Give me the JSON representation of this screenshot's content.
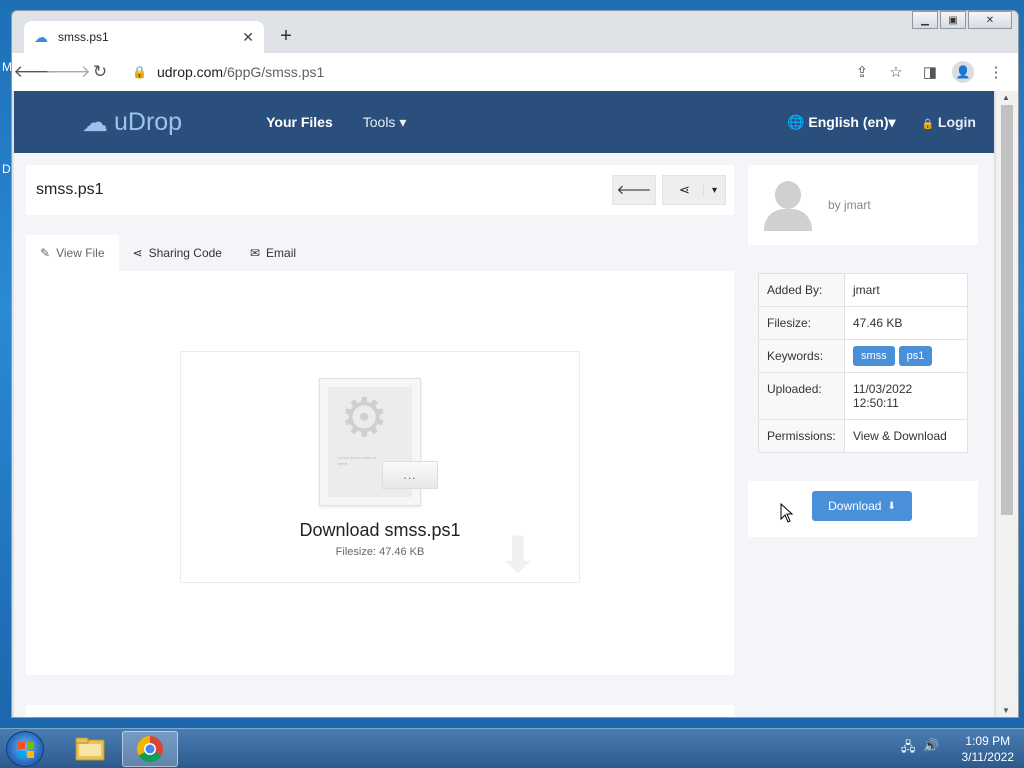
{
  "desktop": {
    "icon_text_1": "M",
    "icon_text_2": "D"
  },
  "browser": {
    "tab_title": "smss.ps1",
    "new_tab": "+",
    "url_host": "udrop.com",
    "url_path": "/6ppG/smss.ps1"
  },
  "site": {
    "logo_text": "uDrop",
    "nav_files": "Your Files",
    "nav_tools": "Tools ▾",
    "nav_language": "English (en)▾",
    "nav_login": "Login"
  },
  "file": {
    "title": "smss.ps1",
    "tabs": [
      {
        "label": "View File"
      },
      {
        "label": "Sharing Code"
      },
      {
        "label": "Email"
      }
    ],
    "preview_lines": "Lorem ipsum dolor sit amet",
    "preview_dots": "...",
    "download_title": "Download smss.ps1",
    "download_filesize": "Filesize: 47.46 KB"
  },
  "sidebar": {
    "by_user": "by jmart",
    "info": [
      {
        "label": "Added By:",
        "value": "jmart"
      },
      {
        "label": "Filesize:",
        "value": "47.46 KB"
      },
      {
        "label": "Keywords:",
        "keywords": [
          "smss",
          "ps1"
        ]
      },
      {
        "label": "Uploaded:",
        "value": "11/03/2022",
        "value2": "12:50:11"
      },
      {
        "label": "Permissions:",
        "value": "View & Download"
      }
    ],
    "download_label": "Download"
  },
  "taskbar": {
    "time": "1:09 PM",
    "date": "3/11/2022"
  }
}
